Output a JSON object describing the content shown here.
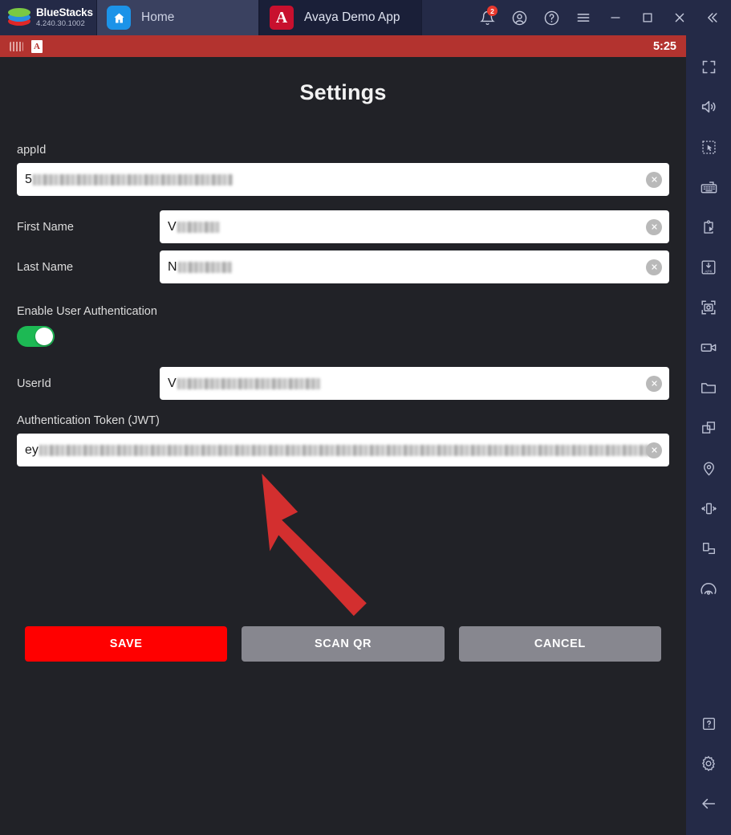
{
  "titlebar": {
    "brand_name": "BlueStacks",
    "version": "4.240.30.1002",
    "tabs": [
      {
        "label": "Home",
        "icon": "home-icon",
        "active": true
      },
      {
        "label": "Avaya Demo App",
        "icon": "avaya-a-icon",
        "active": false
      }
    ],
    "controls": [
      {
        "name": "notifications-bell-icon",
        "badge": "2"
      },
      {
        "name": "account-icon",
        "badge": ""
      },
      {
        "name": "help-circle-icon",
        "badge": ""
      },
      {
        "name": "hamburger-menu-icon",
        "badge": ""
      },
      {
        "name": "minimize-icon",
        "badge": ""
      },
      {
        "name": "maximize-icon",
        "badge": ""
      },
      {
        "name": "close-icon",
        "badge": ""
      },
      {
        "name": "collapse-sidebar-icon",
        "badge": ""
      }
    ]
  },
  "statusbar": {
    "keyboard_icon": "keyboard-icon",
    "app_icon_letter": "A",
    "time": "5:25"
  },
  "screen": {
    "title": "Settings",
    "fields": {
      "app_id": {
        "label": "appId",
        "value_prefix": "5",
        "redacted": true,
        "clear_icon": "clear-circle-icon"
      },
      "first_name": {
        "label": "First Name",
        "value_prefix": "V",
        "redacted": true,
        "clear_icon": "clear-circle-icon"
      },
      "last_name": {
        "label": "Last Name",
        "value_prefix": "N",
        "redacted": true,
        "clear_icon": "clear-circle-icon"
      },
      "enable_user_auth": {
        "label": "Enable User Authentication",
        "state": "on"
      },
      "user_id": {
        "label": "UserId",
        "value_prefix": "V",
        "redacted": true,
        "clear_icon": "clear-circle-icon"
      },
      "auth_token": {
        "label": "Authentication Token (JWT)",
        "value_prefix": "ey",
        "redacted": true,
        "clear_icon": "clear-circle-icon"
      }
    },
    "buttons": {
      "save": "SAVE",
      "scan_qr": "SCAN QR",
      "cancel": "CANCEL"
    },
    "annotation": {
      "type": "arrow",
      "color": "#d32f2f",
      "points_to": "Authentication Token (JWT)"
    }
  },
  "sidebar": {
    "top_icons": [
      "fullscreen-icon",
      "volume-icon",
      "cursor-select-icon",
      "keyboard-controls-icon",
      "macro-script-icon",
      "install-apk-icon",
      "screenshot-icon",
      "record-video-icon",
      "media-folder-icon",
      "multi-instance-icon",
      "location-pin-icon",
      "shake-device-icon",
      "rotate-screen-icon",
      "gamepad-icon"
    ],
    "bottom_icons": [
      "help-box-icon",
      "settings-gear-icon",
      "back-arrow-icon"
    ]
  },
  "colors": {
    "titlebar_bg": "#242a47",
    "tab_active_bg": "#3a4160",
    "tab_inactive_bg": "#1a1f38",
    "status_bar_red": "#b3332f",
    "screen_bg": "#212227",
    "save_red": "#ff0000",
    "gray_button": "#87878f",
    "toggle_green": "#1db954",
    "annotation_red": "#d32f2f",
    "home_icon_blue": "#1c93e8",
    "avaya_red": "#c8102e"
  }
}
